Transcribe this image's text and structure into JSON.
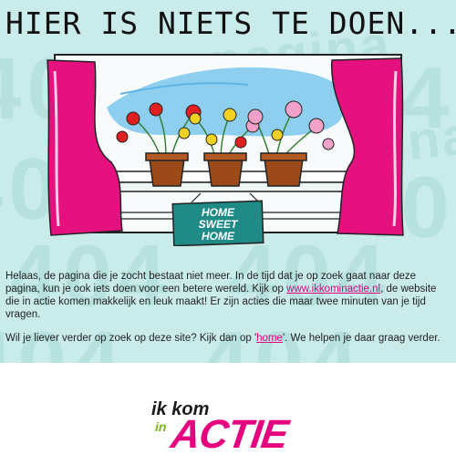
{
  "page": {
    "heading": "HIER IS NIETS TE DOEN...",
    "watermark": {
      "word": "pagina",
      "number": "404"
    },
    "illustration": {
      "sign_text": [
        "HOME",
        "SWEET",
        "HOME"
      ],
      "colors": {
        "curtain": "#e4117f",
        "sky": "#8ecff0",
        "sign": "#1f8a86",
        "pot": "#9c4a1a"
      }
    },
    "body": {
      "paragraph1": {
        "before_link": "Helaas, de pagina die je zocht bestaat niet meer. In de tijd dat je op zoek gaat naar deze pagina, kun je ook iets doen voor een betere wereld. Kijk op ",
        "link_text": "www.ikkominactie.nl",
        "after_link": ", de website die in actie komen mak­kelijk en leuk maakt! Er zijn acties die maar twee minuten van je tijd vragen."
      },
      "paragraph2": {
        "before_link": "Wil je liever verder op zoek op deze site? Kijk dan op '",
        "link_text": "home",
        "after_link": "'. We helpen je daar graag verder."
      }
    },
    "logo": {
      "line1": "ik kom",
      "line2": "in",
      "line3": "ACTIE",
      "colors": {
        "dark": "#1a1a1a",
        "accent": "#e6007e",
        "green": "#7ab51d"
      }
    }
  }
}
